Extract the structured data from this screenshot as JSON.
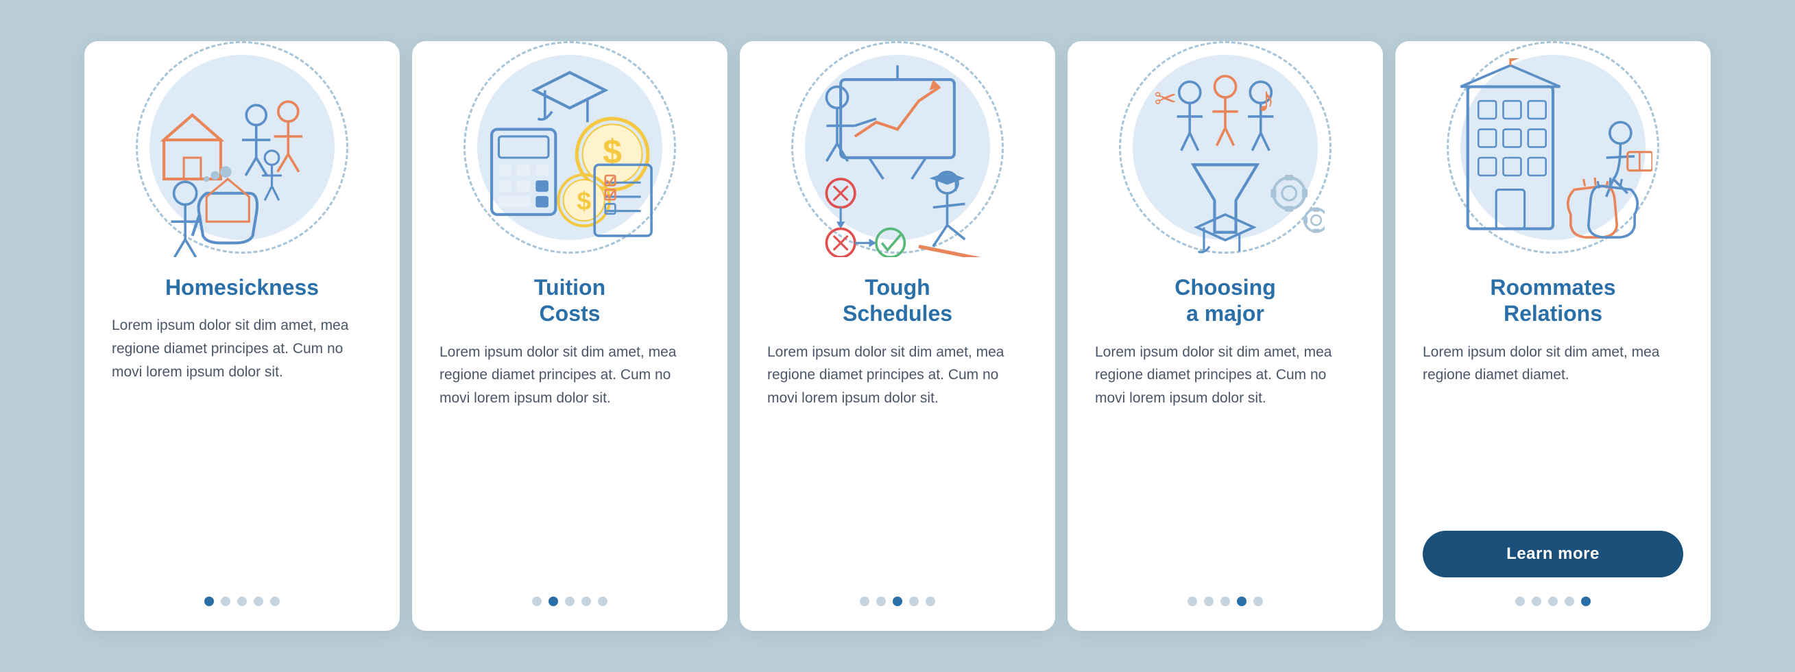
{
  "cards": [
    {
      "id": "homesickness",
      "title": "Homesickness",
      "text": "Lorem ipsum dolor sit dim amet, mea regione diamet principes at. Cum no movi lorem ipsum dolor sit.",
      "dots": [
        true,
        false,
        false,
        false,
        false
      ],
      "show_button": false,
      "button_label": null
    },
    {
      "id": "tuition-costs",
      "title": "Tuition\nCosts",
      "text": "Lorem ipsum dolor sit dim amet, mea regione diamet principes at. Cum no movi lorem ipsum dolor sit.",
      "dots": [
        false,
        true,
        false,
        false,
        false
      ],
      "show_button": false,
      "button_label": null
    },
    {
      "id": "tough-schedules",
      "title": "Tough\nSchedules",
      "text": "Lorem ipsum dolor sit dim amet, mea regione diamet principes at. Cum no movi lorem ipsum dolor sit.",
      "dots": [
        false,
        false,
        true,
        false,
        false
      ],
      "show_button": false,
      "button_label": null
    },
    {
      "id": "choosing-a-major",
      "title": "Choosing\na major",
      "text": "Lorem ipsum dolor sit dim amet, mea regione diamet principes at. Cum no movi lorem ipsum dolor sit.",
      "dots": [
        false,
        false,
        false,
        true,
        false
      ],
      "show_button": false,
      "button_label": null
    },
    {
      "id": "roommates-relations",
      "title": "Roommates\nRelations",
      "text": "Lorem ipsum dolor sit dim amet, mea regione diamet diamet.",
      "dots": [
        false,
        false,
        false,
        false,
        true
      ],
      "show_button": true,
      "button_label": "Learn more"
    }
  ]
}
